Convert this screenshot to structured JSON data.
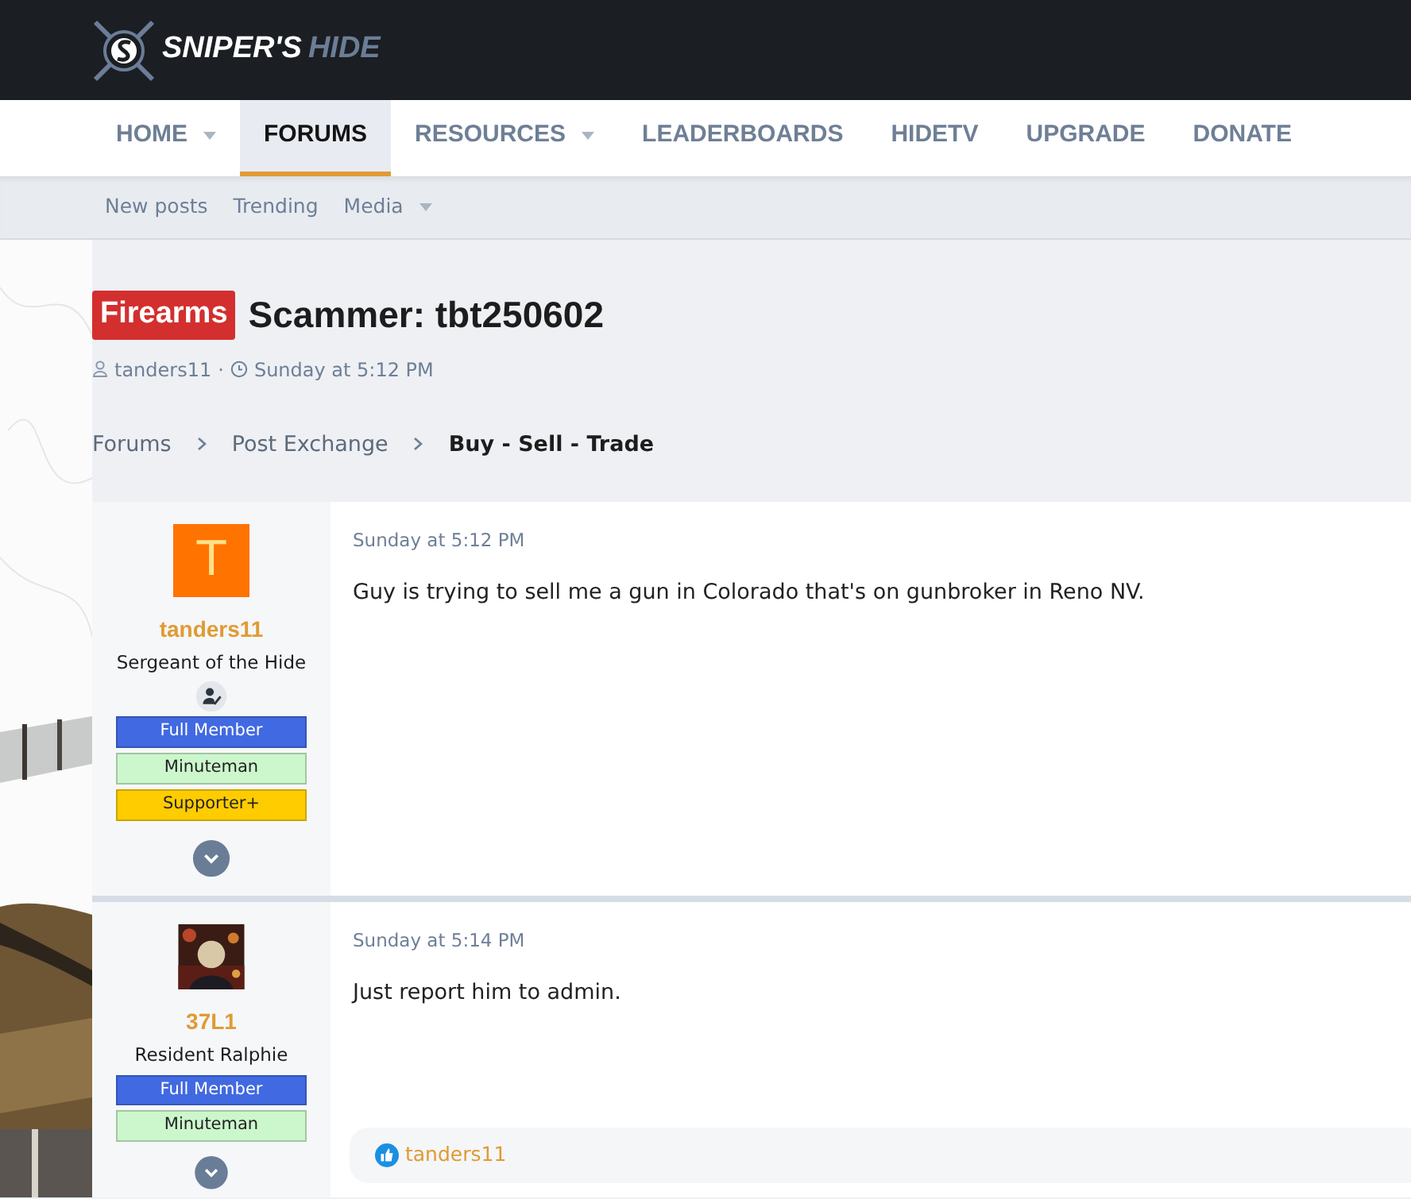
{
  "logo": {
    "word_1": "SNIPER'S",
    "word_2": "HIDE"
  },
  "nav": [
    {
      "label": "HOME",
      "selected": false,
      "dropdown": true
    },
    {
      "label": "FORUMS",
      "selected": true,
      "dropdown": false
    },
    {
      "label": "RESOURCES",
      "selected": false,
      "dropdown": true
    },
    {
      "label": "LEADERBOARDS",
      "selected": false,
      "dropdown": false
    },
    {
      "label": "HIDETV",
      "selected": false,
      "dropdown": false
    },
    {
      "label": "UPGRADE",
      "selected": false,
      "dropdown": false
    },
    {
      "label": "DONATE",
      "selected": false,
      "dropdown": false
    }
  ],
  "subnav": [
    {
      "label": "New posts",
      "dropdown": false
    },
    {
      "label": "Trending",
      "dropdown": false
    },
    {
      "label": "Media",
      "dropdown": true
    }
  ],
  "thread": {
    "prefix": "Firearms",
    "title": "Scammer: tbt250602",
    "author": "tanders11",
    "separator": "·",
    "date": "Sunday at 5:12 PM"
  },
  "breadcrumbs": [
    {
      "label": "Forums",
      "current": false
    },
    {
      "label": "Post Exchange",
      "current": false
    },
    {
      "label": "Buy - Sell - Trade",
      "current": true
    }
  ],
  "posts": [
    {
      "user": "tanders11",
      "avatar": {
        "kind": "letter",
        "letter": "T",
        "color": "#ff7300"
      },
      "rank": "Sergeant of the Hide",
      "verified": true,
      "banners": [
        {
          "label": "Full Member",
          "color": "#4169e1"
        },
        {
          "label": "Minuteman",
          "color": "#ccf7cc"
        },
        {
          "label": "Supporter+",
          "color": "#ffcc00"
        }
      ],
      "date": "Sunday at 5:12 PM",
      "body": "Guy is trying to sell me a gun in Colorado that's on gunbroker in Reno NV."
    },
    {
      "user": "37L1",
      "avatar": {
        "kind": "picture"
      },
      "rank": "Resident Ralphie",
      "verified": false,
      "banners": [
        {
          "label": "Full Member",
          "color": "#4169e1"
        },
        {
          "label": "Minuteman",
          "color": "#ccf7cc"
        }
      ],
      "date": "Sunday at 5:14 PM",
      "body": "Just report him to admin.",
      "likes": "tanders11"
    }
  ]
}
